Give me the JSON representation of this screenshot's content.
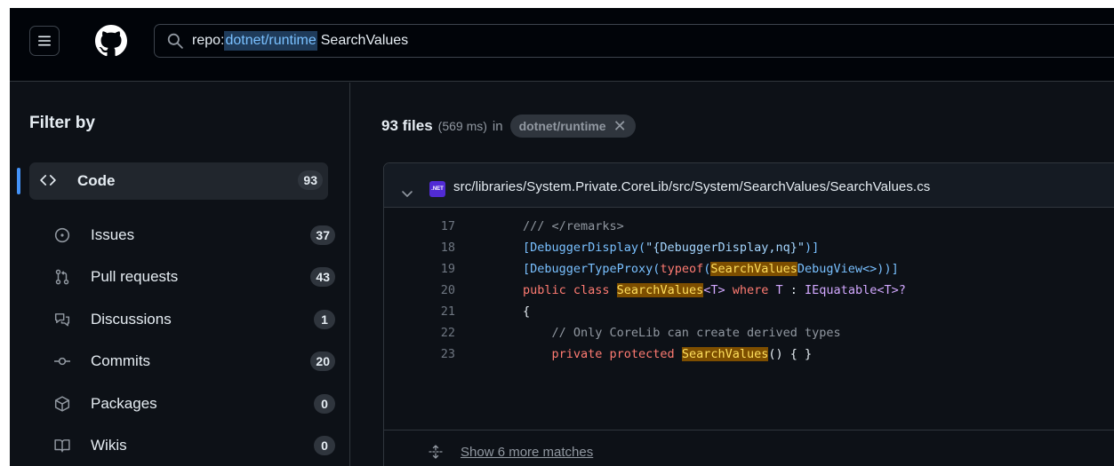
{
  "header": {
    "search": {
      "qualifier": "repo:",
      "repo": "dotnet/runtime",
      "term": "SearchValues"
    }
  },
  "sidebar": {
    "title": "Filter by",
    "items": [
      {
        "label": "Code",
        "count": "93",
        "icon": "code-icon"
      },
      {
        "label": "Issues",
        "count": "37",
        "icon": "issue-opened-icon"
      },
      {
        "label": "Pull requests",
        "count": "43",
        "icon": "git-pull-request-icon"
      },
      {
        "label": "Discussions",
        "count": "1",
        "icon": "comment-discussion-icon"
      },
      {
        "label": "Commits",
        "count": "20",
        "icon": "git-commit-icon"
      },
      {
        "label": "Packages",
        "count": "0",
        "icon": "package-icon"
      },
      {
        "label": "Wikis",
        "count": "0",
        "icon": "book-icon"
      }
    ]
  },
  "results": {
    "count": "93 files",
    "time": "(569 ms)",
    "in_label": "in",
    "repo_pill": "dotnet/runtime"
  },
  "result_card": {
    "path": "src/libraries/System.Private.CoreLib/src/System/SearchValues/SearchValues.cs",
    "badge": ".NET",
    "code_lines": [
      {
        "num": "17",
        "text": "/// </remarks>"
      },
      {
        "num": "18",
        "text": "[DebuggerDisplay(\"{DebuggerDisplay,nq}\")]"
      },
      {
        "num": "19",
        "text": "[DebuggerTypeProxy(typeof(SearchValuesDebugView<>))]"
      },
      {
        "num": "20",
        "text": "public class SearchValues<T> where T : IEquatable<T>?"
      },
      {
        "num": "21",
        "text": "{"
      },
      {
        "num": "22",
        "text": "    // Only CoreLib can create derived types"
      },
      {
        "num": "23",
        "text": "    private protected SearchValues() { }"
      }
    ],
    "more_matches": "Show 6 more matches"
  },
  "colors": {
    "background": "#0d1117",
    "accent": "#4493f8",
    "highlight": "#7d4e00"
  }
}
